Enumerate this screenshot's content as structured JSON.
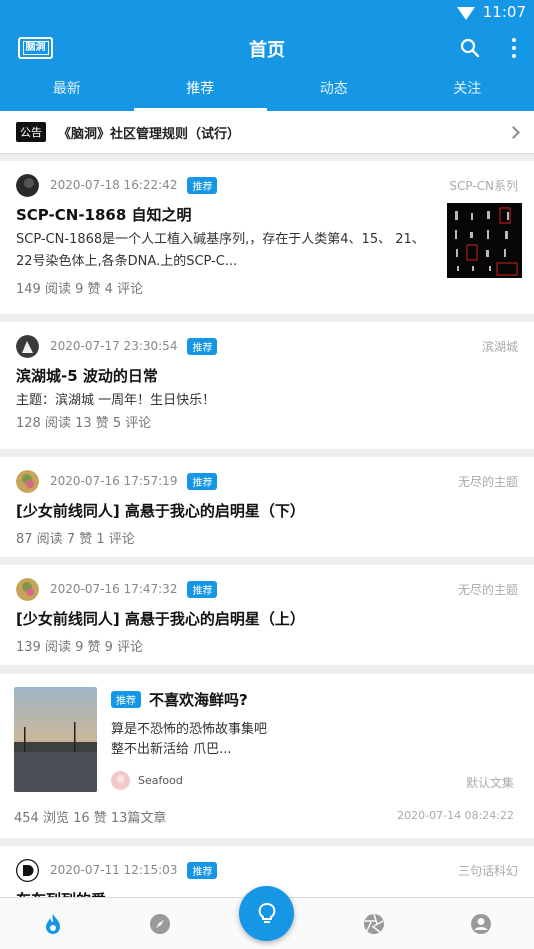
{
  "status_bar": {
    "time": "11:07"
  },
  "app_bar": {
    "logo_text": "脑洞",
    "title": "首页"
  },
  "tabs": [
    {
      "label": "最新",
      "active": false
    },
    {
      "label": "推荐",
      "active": true
    },
    {
      "label": "动态",
      "active": false
    },
    {
      "label": "关注",
      "active": false
    }
  ],
  "notice": {
    "tag": "公告",
    "text": "《脑洞》社区管理规则（试行）"
  },
  "posts": [
    {
      "date": "2020-07-18 16:22:42",
      "badge": "推荐",
      "category": "SCP-CN系列",
      "title": "SCP-CN-1868 自知之明",
      "desc": "SCP-CN-1868是一个人工植入碱基序列,，存在于人类第4、15、 21、 22号染色体上,各条DNA.上的SCP-C...",
      "stats": "149 阅读 9 赞 4 评论"
    },
    {
      "date": "2020-07-17 23:30:54",
      "badge": "推荐",
      "category": "滨湖城",
      "title": "滨湖城-5   波动的日常",
      "desc": "主题：滨湖城   一周年！生日快乐！",
      "stats": "128 阅读 13 赞 5 评论"
    },
    {
      "date": "2020-07-16 17:57:19",
      "badge": "推荐",
      "category": "无尽的主题",
      "title": "[少女前线同人] 高悬于我心的启明星（下）",
      "stats": "87 阅读 7 赞 1 评论"
    },
    {
      "date": "2020-07-16 17:47:32",
      "badge": "推荐",
      "category": "无尽的主题",
      "title": "[少女前线同人] 高悬于我心的启明星（上）",
      "stats": "139 阅读 9 赞 9 评论"
    }
  ],
  "collection": {
    "badge": "推荐",
    "title": "不喜欢海鲜吗?",
    "desc1": "算是不恐怖的恐怖故事集吧",
    "desc2": "整不出新活给     爪巴...",
    "author": "Seafood",
    "category": "默认文集",
    "stats": "454 浏览 16 赞 13篇文章",
    "date": "2020-07-14 08:24:22"
  },
  "last_post": {
    "date": "2020-07-11 12:15:03",
    "badge": "推荐",
    "category": "三句话科幻",
    "title": "车车列列的爱"
  },
  "colors": {
    "accent": "#1597e6"
  },
  "bottom_nav": [
    "flame-icon",
    "compass-icon",
    "lightbulb-icon",
    "aperture-icon",
    "user-icon"
  ]
}
